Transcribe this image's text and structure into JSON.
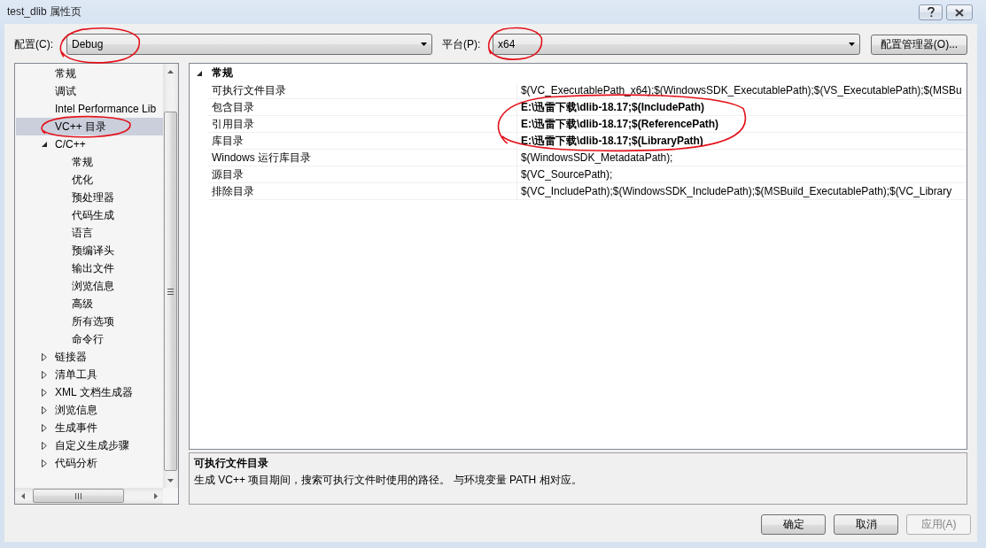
{
  "window": {
    "title": "test_dlib 属性页"
  },
  "toolbar": {
    "configuration": {
      "label": "配置(C):",
      "value": "Debug",
      "circled": true
    },
    "platform": {
      "label": "平台(P):",
      "value": "x64",
      "circled": true
    },
    "manager_button": {
      "label": "配置管理器(O)..."
    }
  },
  "tree": {
    "items": [
      {
        "label": "常规",
        "selected": false,
        "circled": false
      },
      {
        "label": "调试",
        "selected": false,
        "circled": false
      },
      {
        "label": "Intel Performance Lib",
        "selected": false,
        "circled": false
      },
      {
        "label": "VC++ 目录",
        "selected": true,
        "circled": true
      },
      {
        "label": "C/C++",
        "selected": false,
        "circled": false,
        "expanded": true,
        "children": [
          {
            "label": "常规",
            "selected": false,
            "circled": false
          },
          {
            "label": "优化",
            "selected": false,
            "circled": false
          },
          {
            "label": "预处理器",
            "selected": false,
            "circled": false
          },
          {
            "label": "代码生成",
            "selected": false,
            "circled": false
          },
          {
            "label": "语言",
            "selected": false,
            "circled": false
          },
          {
            "label": "预编译头",
            "selected": false,
            "circled": false
          },
          {
            "label": "输出文件",
            "selected": false,
            "circled": false
          },
          {
            "label": "浏览信息",
            "selected": false,
            "circled": false
          },
          {
            "label": "高级",
            "selected": false,
            "circled": false
          },
          {
            "label": "所有选项",
            "selected": false,
            "circled": false
          },
          {
            "label": "命令行",
            "selected": false,
            "circled": false
          }
        ]
      },
      {
        "label": "链接器",
        "selected": false,
        "circled": false,
        "expanded": false
      },
      {
        "label": "清单工具",
        "selected": false,
        "circled": false,
        "expanded": false
      },
      {
        "label": "XML 文档生成器",
        "selected": false,
        "circled": false,
        "expanded": false
      },
      {
        "label": "浏览信息",
        "selected": false,
        "circled": false,
        "expanded": false
      },
      {
        "label": "生成事件",
        "selected": false,
        "circled": false,
        "expanded": false
      },
      {
        "label": "自定义生成步骤",
        "selected": false,
        "circled": false,
        "expanded": false
      },
      {
        "label": "代码分析",
        "selected": false,
        "circled": false,
        "expanded": false
      }
    ]
  },
  "properties": {
    "category": {
      "label": "常规",
      "expanded": true
    },
    "rows": [
      {
        "name": "可执行文件目录",
        "value": "$(VC_ExecutablePath_x64);$(WindowsSDK_ExecutablePath);$(VS_ExecutablePath);$(MSBu",
        "bold": false,
        "circled": false
      },
      {
        "name": "包含目录",
        "value": "E:\\迅雷下载\\dlib-18.17;$(IncludePath)",
        "bold": true,
        "circled": true
      },
      {
        "name": "引用目录",
        "value": "E:\\迅雷下载\\dlib-18.17;$(ReferencePath)",
        "bold": true,
        "circled": true
      },
      {
        "name": "库目录",
        "value": "E:\\迅雷下载\\dlib-18.17;$(LibraryPath)",
        "bold": true,
        "circled": true
      },
      {
        "name": "Windows 运行库目录",
        "value": "$(WindowsSDK_MetadataPath);",
        "bold": false,
        "circled": false
      },
      {
        "name": "源目录",
        "value": "$(VC_SourcePath);",
        "bold": false,
        "circled": false
      },
      {
        "name": "排除目录",
        "value": "$(VC_IncludePath);$(WindowsSDK_IncludePath);$(MSBuild_ExecutablePath);$(VC_Library",
        "bold": false,
        "circled": false
      }
    ]
  },
  "description": {
    "title": "可执行文件目录",
    "text": "生成 VC++ 项目期间，搜索可执行文件时使用的路径。 与环境变量 PATH 相对应。"
  },
  "buttons": [
    {
      "label": "确定",
      "disabled": false
    },
    {
      "label": "取消",
      "disabled": false
    },
    {
      "label": "应用(A)",
      "disabled": true
    }
  ]
}
